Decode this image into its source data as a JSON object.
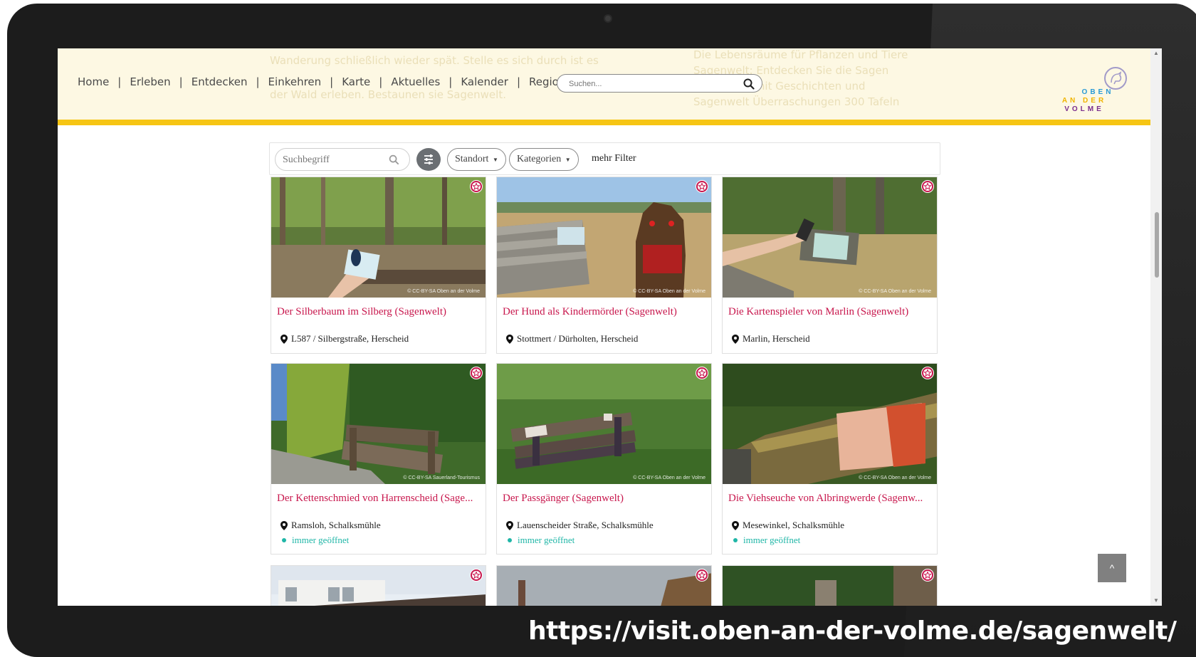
{
  "header": {
    "nav": [
      "Home",
      "Erleben",
      "Entdecken",
      "Einkehren",
      "Karte",
      "Aktuelles",
      "Kalender",
      "Region"
    ],
    "search_placeholder": "Suchen...",
    "logo_lines": [
      "OBEN",
      "AN DER",
      "VOLME"
    ],
    "logo_colors": [
      "#2a9ad6",
      "#f0b400",
      "#7b2d8e"
    ],
    "accent_bar_color": "#f6c514"
  },
  "filter": {
    "search_placeholder": "Suchbegriff",
    "standort": "Standort",
    "kategorien": "Kategorien",
    "more": "mehr Filter"
  },
  "cards": [
    {
      "title": "Der Silberbaum im Silberg (Sagenwelt)",
      "location": "L587 / Silbergstraße, Herscheid",
      "status": "",
      "credit": "© CC-BY-SA Oben an der Volme",
      "scene": "forest"
    },
    {
      "title": "Der Hund als Kindermörder (Sagenwelt)",
      "location": "Stottmert / Dürholten, Herscheid",
      "status": "",
      "credit": "© CC-BY-SA Oben an der Volme",
      "scene": "dog"
    },
    {
      "title": "Die Kartenspieler von Marlin (Sagenwelt)",
      "location": "Marlin, Herscheid",
      "status": "",
      "credit": "© CC-BY-SA Oben an der Volme",
      "scene": "phone"
    },
    {
      "title": "Der Kettenschmied von Harrenscheid (Sage...",
      "location": "Ramsloh, Schalksmühle",
      "status": "immer geöffnet",
      "credit": "© CC-BY-SA Sauerland-Tourismus",
      "scene": "bench-hedge"
    },
    {
      "title": "Der Passgänger (Sagenwelt)",
      "location": "Lauenscheider Straße, Schalksmühle",
      "status": "immer geöffnet",
      "credit": "© CC-BY-SA Oben an der Volme",
      "scene": "bench-grass"
    },
    {
      "title": "Die Viehseuche von Albringwerde (Sagenw...",
      "location": "Mesewinkel, Schalksmühle",
      "status": "immer geöffnet",
      "credit": "© CC-BY-SA Oben an der Volme",
      "scene": "bench-sign"
    }
  ],
  "back_to_top": "^",
  "url_caption": "https://visit.oben-an-der-volme.de/sagenwelt/"
}
